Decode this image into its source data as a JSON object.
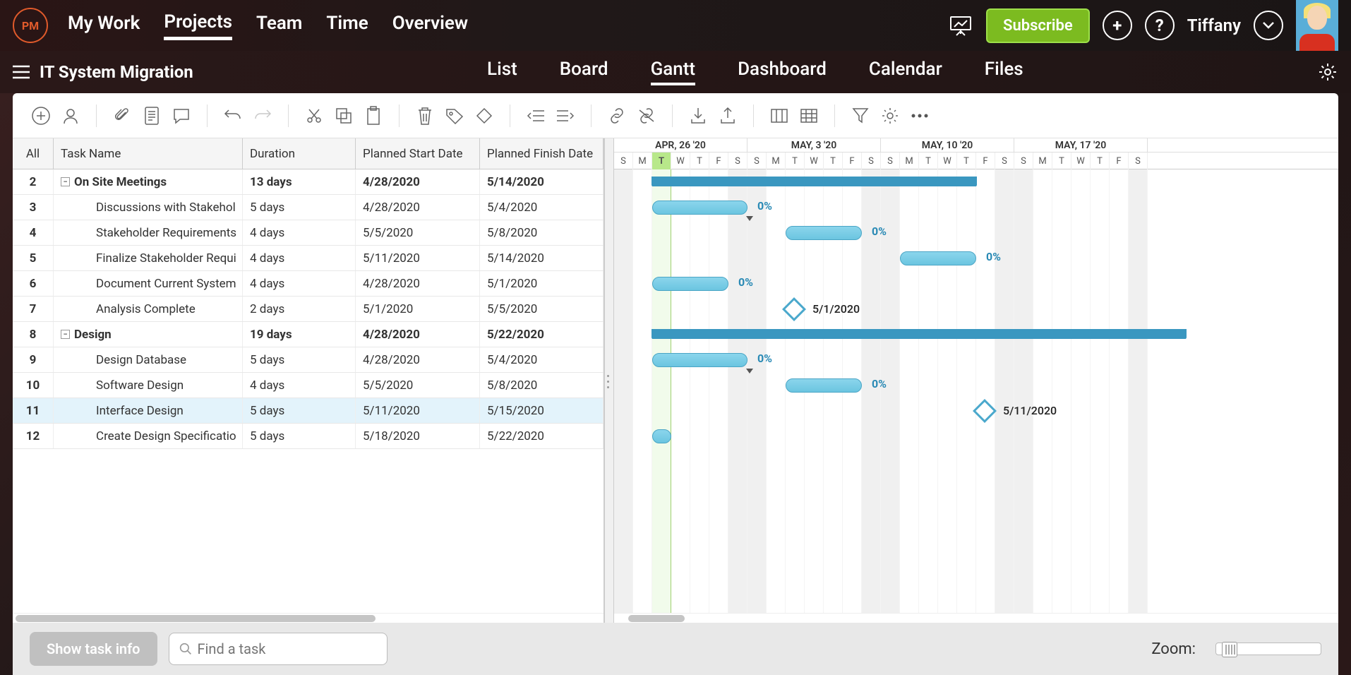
{
  "topnav": {
    "logo": "PM",
    "items": [
      "My Work",
      "Projects",
      "Team",
      "Time",
      "Overview"
    ],
    "active": 1,
    "subscribe": "Subscribe",
    "username": "Tiffany"
  },
  "subheader": {
    "project": "IT System Migration",
    "tabs": [
      "List",
      "Board",
      "Gantt",
      "Dashboard",
      "Calendar",
      "Files"
    ],
    "active": 2
  },
  "table": {
    "headers": {
      "num": "All",
      "name": "Task Name",
      "duration": "Duration",
      "start": "Planned Start Date",
      "finish": "Planned Finish Date"
    },
    "rows": [
      {
        "num": "2",
        "name": "On Site Meetings",
        "dur": "13 days",
        "start": "4/28/2020",
        "finish": "5/14/2020",
        "summary": true
      },
      {
        "num": "3",
        "name": "Discussions with Stakehol",
        "dur": "5 days",
        "start": "4/28/2020",
        "finish": "5/4/2020"
      },
      {
        "num": "4",
        "name": "Stakeholder Requirements",
        "dur": "4 days",
        "start": "5/5/2020",
        "finish": "5/8/2020"
      },
      {
        "num": "5",
        "name": "Finalize Stakeholder Requi",
        "dur": "4 days",
        "start": "5/11/2020",
        "finish": "5/14/2020"
      },
      {
        "num": "6",
        "name": "Document Current System",
        "dur": "4 days",
        "start": "4/28/2020",
        "finish": "5/1/2020"
      },
      {
        "num": "7",
        "name": "Analysis Complete",
        "dur": "2 days",
        "start": "5/1/2020",
        "finish": "5/5/2020"
      },
      {
        "num": "8",
        "name": "Design",
        "dur": "19 days",
        "start": "4/28/2020",
        "finish": "5/22/2020",
        "summary": true
      },
      {
        "num": "9",
        "name": "Design Database",
        "dur": "5 days",
        "start": "4/28/2020",
        "finish": "5/4/2020"
      },
      {
        "num": "10",
        "name": "Software Design",
        "dur": "4 days",
        "start": "5/5/2020",
        "finish": "5/8/2020"
      },
      {
        "num": "11",
        "name": "Interface Design",
        "dur": "5 days",
        "start": "5/11/2020",
        "finish": "5/15/2020",
        "selected": true
      },
      {
        "num": "12",
        "name": "Create Design Specificatio",
        "dur": "5 days",
        "start": "5/18/2020",
        "finish": "5/22/2020"
      }
    ]
  },
  "gantt": {
    "weeks": [
      "APR, 26 '20",
      "MAY, 3 '20",
      "MAY, 10 '20",
      "MAY, 17 '20"
    ],
    "days": [
      "S",
      "M",
      "T",
      "W",
      "T",
      "F",
      "S"
    ],
    "todayCol": 2,
    "labels": {
      "pct": "0%",
      "ms1": "5/1/2020",
      "ms2": "5/11/2020"
    }
  },
  "footer": {
    "showInfo": "Show task info",
    "searchPlaceholder": "Find a task",
    "zoom": "Zoom:"
  }
}
